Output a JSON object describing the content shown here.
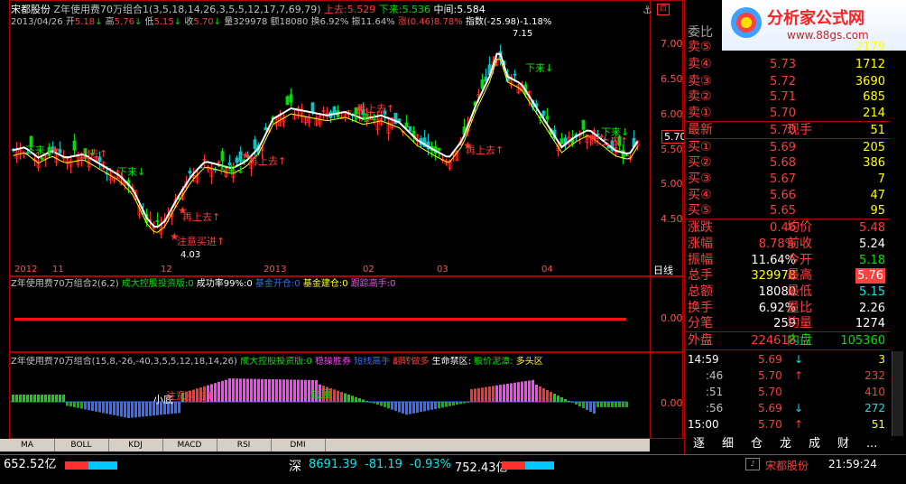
{
  "header": {
    "stock_name": "宋都股份",
    "formula": "Z年使用费70万组合1(3,5,18,14,26,3,5,5,12,17,7,69,79)",
    "up_label": "上去:",
    "up_value": "5.529",
    "down_label": "下来:",
    "down_value": "5.536",
    "mid_label": "中间:",
    "mid_value": "5.584",
    "date": "2013/04/26",
    "open_label": "开",
    "open_value": "5.18",
    "high_label": "高",
    "high_value": "5.76",
    "low_label": "低",
    "low_value": "5.15",
    "close_label": "收",
    "close_value": "5.70",
    "vol_label": "量",
    "vol_value": "329978",
    "amount_label": "额",
    "amount_value": "18080",
    "turnover_label": "换",
    "turnover_value": "6.92%",
    "amp_label": "振",
    "amp_value": "11.64%",
    "chg_label": "涨",
    "chg_value": "(0.46)8.78%",
    "index_label": "指数",
    "index_value": "(-25.98)-1.18%"
  },
  "main_chart": {
    "y_ticks": [
      "7.00",
      "6.50",
      "6.00",
      "5.50",
      "5.00",
      "4.50"
    ],
    "current_price": "5.70",
    "high_mark": "7.15",
    "low_mark": "4.03",
    "x_labels": [
      "2012",
      "11",
      "12",
      "2013",
      "02",
      "03",
      "04"
    ],
    "axis_mode": "日线",
    "annotations": [
      {
        "text": "下来↓",
        "color": "#00e000"
      },
      {
        "text": "上去↑",
        "color": "#ff3c3c"
      },
      {
        "text": "再上去↑",
        "color": "#ff3c3c"
      },
      {
        "text": "注意买进↑",
        "color": "#ff3c3c"
      },
      {
        "text": "再上去↑",
        "color": "#ff3c3c"
      },
      {
        "text": "下来↓",
        "color": "#00e000"
      },
      {
        "text": "再上去↑",
        "color": "#ff3c3c"
      },
      {
        "text": "下来↓",
        "color": "#00e000"
      },
      {
        "text": "再上去↑",
        "color": "#ff3c3c"
      },
      {
        "text": "下来↓",
        "color": "#00e000"
      },
      {
        "text": "再上去↑",
        "color": "#ff3c3c"
      },
      {
        "text": "下来↓",
        "color": "#00e000"
      },
      {
        "text": "下来↓",
        "color": "#00e000"
      }
    ]
  },
  "panel2": {
    "title": "Z年使用费70万组合2(6,2)",
    "items": [
      {
        "text": "成大控股投资版:0",
        "color": "#00e000"
      },
      {
        "text": "成功率99%:0",
        "color": "#ffffff"
      },
      {
        "text": "基金开仓:0",
        "color": "#3070ff"
      },
      {
        "text": "基金建仓:0",
        "color": "#ffff00"
      },
      {
        "text": "跟踪高手:0",
        "color": "#ff40ff"
      }
    ],
    "y_tick": "0.00"
  },
  "panel3": {
    "title": "Z年使用费70万组合(15,8,-26,-40,3,5,5,12,18,14,26)",
    "items": [
      {
        "text": "成大控股投资版:0",
        "color": "#00e000"
      },
      {
        "text": "稳操胜券",
        "color": "#ff40ff"
      },
      {
        "text": "短线高手",
        "color": "#3070ff"
      },
      {
        "text": "翻转做多",
        "color": "#ff3c3c"
      },
      {
        "text": "生命禁区:",
        "color": "#ffffff"
      },
      {
        "text": "股价泥潭:",
        "color": "#00e000"
      },
      {
        "text": "多头区",
        "color": "#ffff00"
      }
    ],
    "annotations": [
      "小底",
      "注意买进↑",
      "逃顶"
    ],
    "y_tick": "0.00"
  },
  "bottom_tabs": [
    "MA",
    "BOLL",
    "KDJ",
    "MACD",
    "RSI",
    "DMI"
  ],
  "quote": {
    "weibi_label": "委比",
    "weibi_value": "",
    "sells": [
      {
        "label": "卖⑤",
        "price": "",
        "vol": "2179"
      },
      {
        "label": "卖④",
        "price": "5.73",
        "vol": "1712"
      },
      {
        "label": "卖③",
        "price": "5.72",
        "vol": "3690"
      },
      {
        "label": "卖②",
        "price": "5.71",
        "vol": "685"
      },
      {
        "label": "卖①",
        "price": "5.70",
        "vol": "214"
      }
    ],
    "latest_label": "最新",
    "latest_value": "5.70",
    "hand_label": "现手",
    "hand_value": "51",
    "buys": [
      {
        "label": "买①",
        "price": "5.69",
        "vol": "205"
      },
      {
        "label": "买②",
        "price": "5.68",
        "vol": "386"
      },
      {
        "label": "买③",
        "price": "5.67",
        "vol": "7"
      },
      {
        "label": "买④",
        "price": "5.66",
        "vol": "47"
      },
      {
        "label": "买⑤",
        "price": "5.65",
        "vol": "95"
      }
    ],
    "stats": [
      {
        "k1": "涨跌",
        "v1": "0.46",
        "k2": "均价",
        "v2": "5.48"
      },
      {
        "k1": "涨幅",
        "v1": "8.78%",
        "k2": "前收",
        "v2": "5.24"
      },
      {
        "k1": "振幅",
        "v1": "11.64%",
        "k2": "今开",
        "v2": "5.18"
      },
      {
        "k1": "总手",
        "v1": "329978",
        "k2": "最高",
        "v2": "5.76"
      },
      {
        "k1": "总额",
        "v1": "18080",
        "k2": "最低",
        "v2": "5.15"
      },
      {
        "k1": "换手",
        "v1": "6.92%",
        "k2": "量比",
        "v2": "2.26"
      },
      {
        "k1": "分笔",
        "v1": "259",
        "k2": "均量",
        "v2": "1274"
      }
    ],
    "outer_label": "外盘",
    "outer_value": "224618",
    "inner_label": "内盘",
    "inner_value": "105360"
  },
  "ticks": [
    {
      "time": "14:59",
      "price": "5.69",
      "dir": "↓",
      "vol": "3"
    },
    {
      "time": ":46",
      "price": "5.70",
      "dir": "↑",
      "vol": "232"
    },
    {
      "time": ":51",
      "price": "5.70",
      "dir": "",
      "vol": "410"
    },
    {
      "time": ":56",
      "price": "5.69",
      "dir": "↓",
      "vol": "272"
    },
    {
      "time": "15:00",
      "price": "5.70",
      "dir": "↑",
      "vol": "51"
    }
  ],
  "right_tabs": [
    "逐",
    "细",
    "仓",
    "龙",
    "成",
    "财",
    "..."
  ],
  "logo": {
    "title": "分析家公式网",
    "url": "www.88gs.com"
  },
  "status_bar": {
    "left_value": "652.52亿",
    "market": "深",
    "index": "8691.39",
    "change": "-81.19",
    "pct": "-0.93%",
    "amount": "752.43亿",
    "stock": "宋都股份",
    "time": "21:59:24"
  }
}
